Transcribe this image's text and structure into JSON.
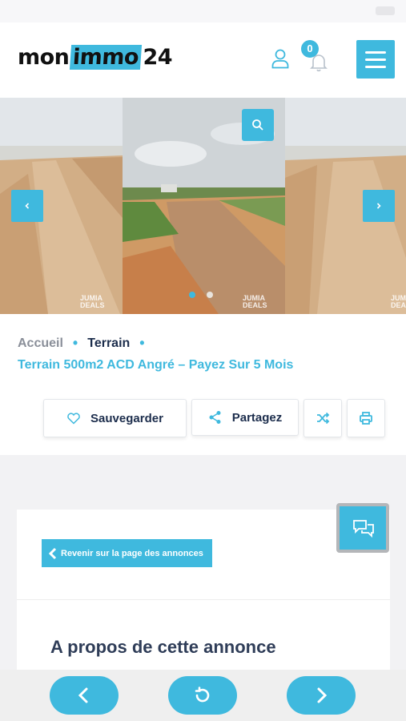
{
  "header": {
    "logo_part1": "mon",
    "logo_part2": "immo",
    "logo_part3": "24",
    "notification_count": "0",
    "icons": {
      "user": "user-icon",
      "bell": "bell-icon",
      "menu": "hamburger-menu-icon"
    }
  },
  "gallery": {
    "watermark_line1": "JUMIA",
    "watermark_line2": "DEALS",
    "slide_count": 2,
    "active_slide": 1,
    "icons": {
      "zoom": "search-icon",
      "prev": "chevron-left-icon",
      "next": "chevron-right-icon"
    }
  },
  "breadcrumb": {
    "home": "Accueil",
    "category": "Terrain",
    "separator": "•"
  },
  "listing": {
    "title": "Terrain 500m2 ACD Angré – Payez Sur 5 Mois"
  },
  "actions": {
    "save_label": "Sauvegarder",
    "share_label": "Partagez",
    "icons": {
      "save": "heart-icon",
      "share": "share-icon",
      "compare": "shuffle-icon",
      "print": "print-icon"
    }
  },
  "content": {
    "back_label": "Revenir sur la page des annonces",
    "about_heading": "A propos de cette annonce",
    "icons": {
      "chat": "chat-icon",
      "back": "chevron-left-icon"
    }
  },
  "bottom_nav": {
    "icons": {
      "back": "chevron-left-icon",
      "reload": "reload-icon",
      "forward": "chevron-right-icon"
    }
  },
  "colors": {
    "accent": "#3fb9de",
    "navy": "#1c2d4c",
    "grey_text": "#8a8f99",
    "background": "#f2f2f4"
  }
}
